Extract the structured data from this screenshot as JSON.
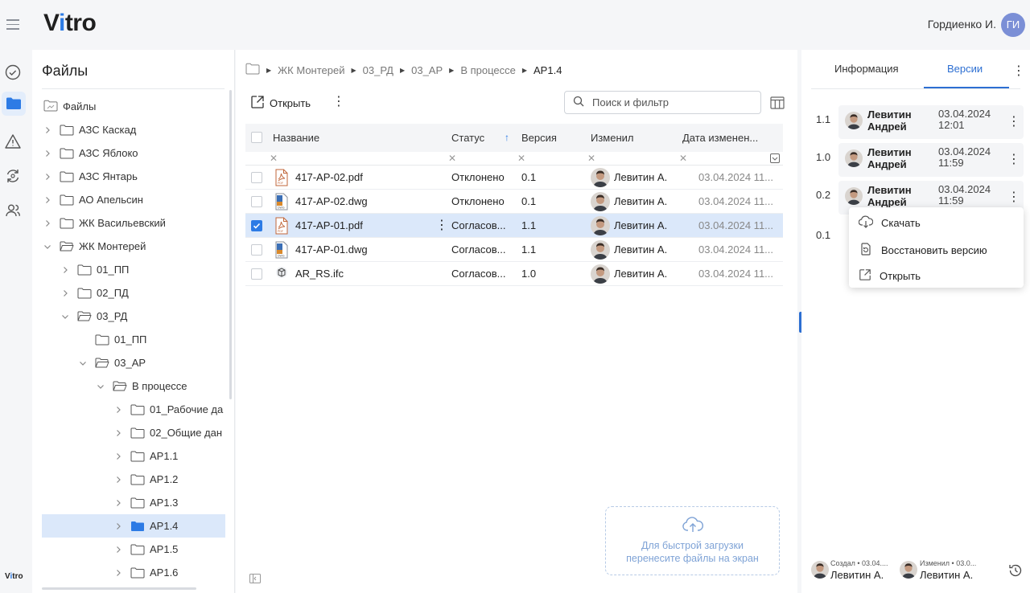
{
  "app": {
    "logo_pre": "V",
    "logo_acc": "i",
    "logo_post": "tro",
    "rail_logo_pre": "V",
    "rail_logo_acc": "i",
    "rail_logo_post": "tro"
  },
  "user": {
    "name": "Гордиенко И.",
    "initials": "ГИ"
  },
  "rail": {
    "icons": [
      "check-circle-icon",
      "folder-icon",
      "warning-icon",
      "sync-icon",
      "users-icon"
    ]
  },
  "tree": {
    "title": "Файлы",
    "root": "Файлы",
    "items": [
      {
        "label": "АЗС Каскад",
        "level": 1,
        "expanded": false
      },
      {
        "label": "АЗС Яблоко",
        "level": 1,
        "expanded": false
      },
      {
        "label": "АЗС Янтарь",
        "level": 1,
        "expanded": false
      },
      {
        "label": "АО Апельсин",
        "level": 1,
        "expanded": false
      },
      {
        "label": "ЖК Васильевский",
        "level": 1,
        "expanded": false
      },
      {
        "label": "ЖК Монтерей",
        "level": 1,
        "expanded": true
      },
      {
        "label": "01_ПП",
        "level": 2,
        "expanded": false
      },
      {
        "label": "02_ПД",
        "level": 2,
        "expanded": false
      },
      {
        "label": "03_РД",
        "level": 2,
        "expanded": true
      },
      {
        "label": "01_ПП",
        "level": 3,
        "expanded": null
      },
      {
        "label": "03_АР",
        "level": 3,
        "expanded": true
      },
      {
        "label": "В процессе",
        "level": 4,
        "expanded": true
      },
      {
        "label": "01_Рабочие да",
        "level": 5,
        "expanded": false
      },
      {
        "label": "02_Общие дан",
        "level": 5,
        "expanded": false
      },
      {
        "label": "АР1.1",
        "level": 5,
        "expanded": false
      },
      {
        "label": "АР1.2",
        "level": 5,
        "expanded": false
      },
      {
        "label": "АР1.3",
        "level": 5,
        "expanded": false
      },
      {
        "label": "АР1.4",
        "level": 5,
        "expanded": false,
        "selected": true
      },
      {
        "label": "АР1.5",
        "level": 5,
        "expanded": false
      },
      {
        "label": "АР1.6",
        "level": 5,
        "expanded": false
      }
    ]
  },
  "breadcrumb": [
    "ЖК Монтерей",
    "03_РД",
    "03_АР",
    "В процессе",
    "АР1.4"
  ],
  "toolbar": {
    "open_label": "Открыть",
    "search_placeholder": "Поиск и фильтр"
  },
  "grid": {
    "columns": [
      "Название",
      "Статус",
      "Версия",
      "Изменил",
      "Дата изменен..."
    ],
    "rows": [
      {
        "name": "417-АР-02.pdf",
        "type": "pdf",
        "status": "Отклонено",
        "version": "0.1",
        "author": "Левитин А.",
        "date": "03.04.2024 11...",
        "checked": false
      },
      {
        "name": "417-АР-02.dwg",
        "type": "dwg",
        "status": "Отклонено",
        "version": "0.1",
        "author": "Левитин А.",
        "date": "03.04.2024 11...",
        "checked": false
      },
      {
        "name": "417-АР-01.pdf",
        "type": "pdf",
        "status": "Согласов...",
        "version": "1.1",
        "author": "Левитин А.",
        "date": "03.04.2024 11...",
        "checked": true
      },
      {
        "name": "417-АР-01.dwg",
        "type": "dwg",
        "status": "Согласов...",
        "version": "1.1",
        "author": "Левитин А.",
        "date": "03.04.2024 11...",
        "checked": false
      },
      {
        "name": "AR_RS.ifc",
        "type": "ifc",
        "status": "Согласов...",
        "version": "1.0",
        "author": "Левитин А.",
        "date": "03.04.2024 11...",
        "checked": false
      }
    ]
  },
  "dropzone": {
    "line1": "Для быстрой загрузки",
    "line2": "перенесите файлы на экран"
  },
  "right": {
    "tabs": [
      "Информация",
      "Версии"
    ],
    "active_tab": "Версии",
    "versions": [
      {
        "num": "1.1",
        "name1": "Левитин",
        "name2": "Андрей",
        "date": "03.04.2024",
        "time": "12:01"
      },
      {
        "num": "1.0",
        "name1": "Левитин",
        "name2": "Андрей",
        "date": "03.04.2024",
        "time": "11:59"
      },
      {
        "num": "0.2",
        "name1": "Левитин",
        "name2": "Андрей",
        "date": "03.04.2024",
        "time": "11:59"
      },
      {
        "num": "0.1"
      }
    ],
    "menu": [
      "Скачать",
      "Восстановить версию",
      "Открыть"
    ],
    "footer": {
      "created_label": "Создал • 03.04....",
      "created_name": "Левитин А.",
      "modified_label": "Изменил • 03.0...",
      "modified_name": "Левитин А."
    }
  }
}
